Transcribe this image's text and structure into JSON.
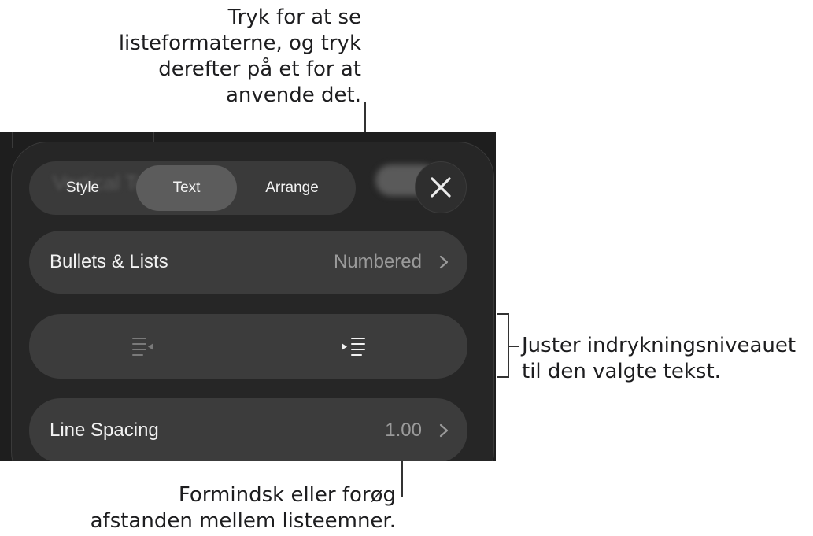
{
  "callouts": {
    "top": [
      "Tryk for at se",
      "listeformaterne, og tryk",
      "derefter på et for at",
      "anvende det."
    ],
    "right": [
      "Juster indrykningsniveauet",
      "til den valgte tekst."
    ],
    "bottom": [
      "Formindsk eller forøg",
      "afstanden mellem listeemner."
    ]
  },
  "panel": {
    "ghost_title": "Vertical Text",
    "tabs": [
      {
        "label": "Style",
        "active": false
      },
      {
        "label": "Text",
        "active": true
      },
      {
        "label": "Arrange",
        "active": false
      }
    ],
    "close_icon": "close-icon",
    "bullets_row": {
      "label": "Bullets & Lists",
      "value": "Numbered",
      "icon": "chevron-right-icon"
    },
    "indent_row": {
      "decrease_icon": "decrease-indent-icon",
      "increase_icon": "increase-indent-icon",
      "decrease_enabled": false
    },
    "spacing_row": {
      "label": "Line Spacing",
      "value": "1.00",
      "icon": "chevron-right-icon"
    }
  },
  "colors": {
    "panel_bg": "#262626",
    "row_bg": "#3c3c3c",
    "active_tab": "#5c5c5c",
    "text": "#f2f2f2",
    "muted": "#9a9a9a"
  }
}
